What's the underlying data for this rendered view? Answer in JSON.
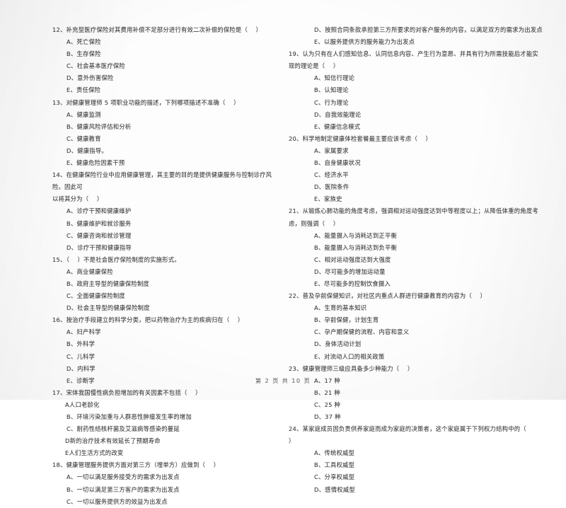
{
  "document": {
    "type": "scanned-exam-paper",
    "footer": "第 2 页  共 10 页",
    "ink_color": "#3b3b3e",
    "page_color": "#fdfdfd"
  },
  "left_column": {
    "q12": {
      "stem": "12、补充型医疗保险对其费用补偿不足部分进行有效二次补偿的保险是（    ）",
      "a": "A、死亡保险",
      "b": "B、生存保险",
      "c": "C、社会基本医疗保险",
      "d": "D、意外伤害保险",
      "e": "E、责任保险"
    },
    "q13": {
      "stem": "13、对健康管理师 5 项职业功能的描述，下列哪项描述不准确（    ）",
      "a": "A、健康监测",
      "b": "B、健康风险评估和分析",
      "c": "C、健康教育",
      "d": "D、健康指导。",
      "e": "E、健康危险因素干预"
    },
    "q14": {
      "stem": "14、在健康保险行业中应用健康管理，其主要的目的是提供健康服务与控制诊疗风险。因此可",
      "stem2": "以将其分为（    ）",
      "a": "A、诊疗干预和健康维护",
      "b": "B、健康维护和就诊服务",
      "c": "C、健康咨询和就诊管理",
      "d": "D、诊疗干预和健康指导"
    },
    "q15": {
      "stem": "15、（    ）不是社会医疗保险制度的实施形式。",
      "a": "A、商业健康保险",
      "b": "B、政府主导型的健康保险制度",
      "c": "C、全面健康保险制度",
      "d": "D、社会主导型的健康保险制度"
    },
    "q16": {
      "stem": "16、按治疗手段建立的科学分类，把以药物治疗为主的疾病归在（    ）",
      "a": "A、妇产科学",
      "b": "B、外科学",
      "c": "C、儿科学",
      "d": "D、内科学",
      "e": "E、诊断学"
    },
    "q17": {
      "stem": "17、宋体我国慢性病负担增加的有关因素不包括（    ）",
      "a": "A人口老龄化",
      "b": "B、环境污染加重与人群恶性肿瘤发生率的增加",
      "c": "C、耐药性结核杆菌及艾滋病等感染的蔓延",
      "d": "D新的治疗技术有效延长了预期寿命",
      "e": "E人们生活方式的改变"
    },
    "q18": {
      "stem": "18、健康管理服务提供方面对第三方（埋单方）应做到（    ）",
      "a": "A、一切以满足服务接受方的需求为出发点",
      "b": "B、一切以满足第三方客户的需求为出发点",
      "c": "C、一切以服务提供方的效益为出发点"
    }
  },
  "right_column": {
    "q18_cont": {
      "d": "D、按照合同条款承担第三方所要求的对客户服务的内容，以满足双方的需求为出发点",
      "e": "E、以服务提供方的服务能力为出发点"
    },
    "q19": {
      "stem": "19、认为只有在人们感知信息、认同信息内容、产生行为意愿、并具有行为所需技能后才能实",
      "stem2": "现的理论是（    ）",
      "a": "A、知信行理论",
      "b": "B、认知理论",
      "c": "C、行为理论",
      "d": "D、自我效能理论",
      "e": "E、健康信念模式"
    },
    "q20": {
      "stem": "20、科学地制定健康体检套餐最主要应该考虑（    ）",
      "a": "A、家属要求",
      "b": "B、自身健康状况",
      "c": "C、经济水平",
      "d": "D、医院条件",
      "e": "E、家族史"
    },
    "q21": {
      "stem": "21、从锻炼心肺功能的角度考虑，强调相对运动强度达到中等程度以上；从降低体重的角度考",
      "stem2": "虑，则强调（    ）",
      "a": "A、能量摄入与消耗达到正平衡",
      "b": "B、能量摄入与消耗达到负平衡",
      "c": "C、相对运动强度达到大强度",
      "d": "D、尽可能多的增加运动量",
      "e": "E、尽可能多的控制饮食摄入"
    },
    "q22": {
      "stem": "22、普及孕前保健知识，对社区内重点人群进行健康教育的内容为（    ）",
      "a": "A、生育的基本知识",
      "b": "B、孕前保健，计划生育",
      "c": "C、孕产期保健的流程、内容和意义",
      "d": "D、身体活动计划",
      "e": "E、对流动人口的相关政策"
    },
    "q23": {
      "stem": "23、健康管理师三级应具备多少种能力（    ）",
      "a": "A、17 种",
      "b": "B、21 种",
      "c": "C、25 种",
      "d": "D、37 种"
    },
    "q24": {
      "stem": "24、某家庭成员因负责供养家庭而成为家庭的决策者，这个家庭属于下列权力结构中的（",
      "stem2": "）",
      "a": "A、传统权威型",
      "b": "B、工具权威型",
      "c": "C、分享权威型",
      "d": "D、感情权威型"
    }
  }
}
